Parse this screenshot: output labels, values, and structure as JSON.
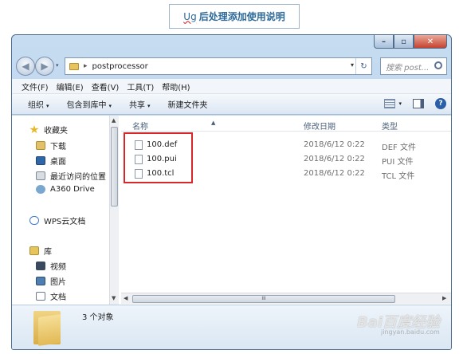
{
  "caption": {
    "ug": "Ug",
    "text": "后处理添加使用说明"
  },
  "window": {
    "buttons": {
      "minimize": "–",
      "maximize": "▫",
      "close": "✕"
    }
  },
  "address": {
    "back": "◀",
    "forward": "▶",
    "path": "postprocessor",
    "separator": "▸",
    "dropdown": "▾",
    "refresh": "↻",
    "search_placeholder": "搜索 post..."
  },
  "menu": [
    "文件(F)",
    "编辑(E)",
    "查看(V)",
    "工具(T)",
    "帮助(H)"
  ],
  "toolbar": {
    "organize": "组织",
    "include_in_library": "包含到库中",
    "share": "共享",
    "new_folder": "新建文件夹",
    "caret": "▾"
  },
  "nav": {
    "favorites": "收藏夹",
    "downloads": "下载",
    "desktop": "桌面",
    "recent": "最近访问的位置",
    "a360": "A360 Drive",
    "wps": "WPS云文档",
    "library": "库",
    "video": "视频",
    "pictures": "图片",
    "documents": "文档"
  },
  "columns": {
    "name": "名称",
    "date": "修改日期",
    "type": "类型",
    "sort_mark": "▲"
  },
  "files": [
    {
      "name": "100.def",
      "date": "2018/6/12 0:22",
      "type": "DEF 文件"
    },
    {
      "name": "100.pui",
      "date": "2018/6/12 0:22",
      "type": "PUI 文件"
    },
    {
      "name": "100.tcl",
      "date": "2018/6/12 0:22",
      "type": "TCL 文件"
    }
  ],
  "scroll": {
    "up": "▲",
    "down": "▼",
    "left": "◀",
    "right": "▶",
    "grip": "III"
  },
  "status": {
    "count": "3 个对象"
  },
  "watermark": {
    "main": "Bai百度经验",
    "sub": "jingyan.baidu.com"
  },
  "colors": {
    "highlight_box": "#d8262b",
    "accent": "#2d6a9a"
  }
}
